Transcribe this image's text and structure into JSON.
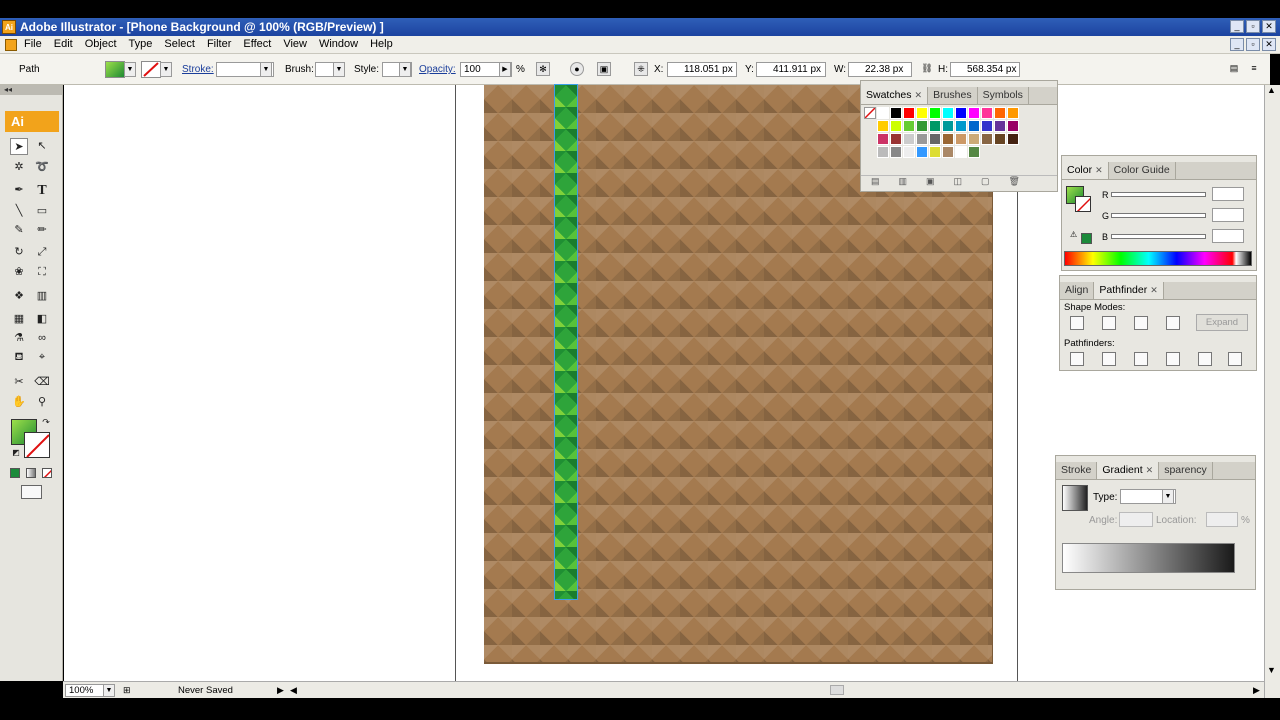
{
  "window": {
    "title": "Adobe Illustrator - [Phone Background @ 100% (RGB/Preview) ]",
    "app_logo": "Ai"
  },
  "menu": [
    "File",
    "Edit",
    "Object",
    "Type",
    "Select",
    "Filter",
    "Effect",
    "View",
    "Window",
    "Help"
  ],
  "control": {
    "selection_type": "Path",
    "stroke_label": "Stroke:",
    "brush_label": "Brush:",
    "style_label": "Style:",
    "opacity_label": "Opacity:",
    "opacity_value": "100",
    "opacity_unit": "%",
    "x_label": "X:",
    "x_value": "118.051 px",
    "y_label": "Y:",
    "y_value": "411.911 px",
    "w_label": "W:",
    "w_value": "22.38 px",
    "h_label": "H:",
    "h_value": "568.354 px"
  },
  "toolbar": {
    "collapse": "◂◂",
    "logo": "Ai"
  },
  "swatches_panel": {
    "tabs": [
      "Swatches",
      "Brushes",
      "Symbols"
    ],
    "colors_row1": [
      "#ffffff",
      "#000000",
      "#ff0000",
      "#ffff00",
      "#00ff00",
      "#00ffff",
      "#0000ff",
      "#ff00ff",
      "#ff3399",
      "#ff6600",
      "#ff9900"
    ],
    "colors_row2": [
      "#ffcc00",
      "#ccff00",
      "#66cc33",
      "#339933",
      "#009966",
      "#009999",
      "#0099cc",
      "#0066cc",
      "#3333cc",
      "#663399",
      "#990066"
    ],
    "colors_row3": [
      "#cc3366",
      "#993333",
      "#cccccc",
      "#999999",
      "#666666",
      "#996633",
      "#cc9966",
      "#ccaa77",
      "#886644",
      "#664422",
      "#442211"
    ],
    "colors_row4": [
      "#bbbbbb",
      "#888888",
      "#eeeeee",
      "#3399ff",
      "#dddd33",
      "#aa8866",
      "#ffffff",
      "#558844"
    ]
  },
  "color_panel": {
    "tabs": [
      "Color",
      "Color Guide"
    ],
    "labels": [
      "R",
      "G",
      "B"
    ]
  },
  "pathfinder_panel": {
    "tabs": [
      "Align",
      "Pathfinder"
    ],
    "shape_modes_label": "Shape Modes:",
    "pathfinders_label": "Pathfinders:",
    "expand_label": "Expand"
  },
  "gradient_panel": {
    "tabs": [
      "Stroke",
      "Gradient",
      "Transparency"
    ],
    "tab_visible_text": [
      "Stroke",
      "Gradient",
      "sparency"
    ],
    "type_label": "Type:",
    "angle_label": "Angle:",
    "location_label": "Location:",
    "percent": "%"
  },
  "status": {
    "zoom": "100%",
    "save_state": "Never Saved"
  },
  "colors": {
    "title_bar": "#1c43a0",
    "accent_orange": "#f2a31b",
    "pattern_brown": "#a47a4f",
    "stripe_green": "#2ea43a"
  }
}
